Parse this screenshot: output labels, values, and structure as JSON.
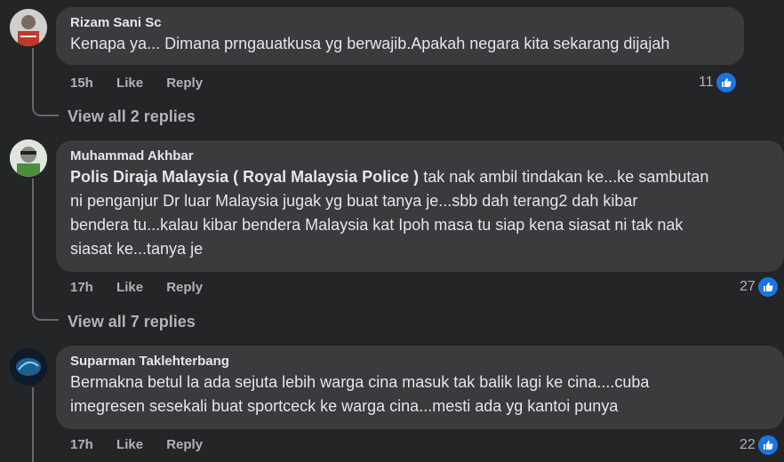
{
  "comments": [
    {
      "author": "Rizam Sani Sc",
      "text": "Kenapa ya... Dimana prngauatkusa yg berwajib.Apakah negara kita sekarang dijajah",
      "time": "15h",
      "like_label": "Like",
      "reply_label": "Reply",
      "reaction_count": "11",
      "view_replies": "View all 2 replies"
    },
    {
      "author": "Muhammad Akhbar",
      "mention": "Polis Diraja Malaysia ( Royal Malaysia Police )",
      "text_line1_rest": " tak nak ambil tindakan ke...ke sambutan",
      "text_line2": "ni penganjur Dr luar Malaysia jugak yg buat tanya je...sbb dah terang2 dah kibar",
      "text_line3": "bendera tu...kalau kibar bendera Malaysia kat Ipoh masa tu siap kena siasat ni tak nak",
      "text_line4": "siasat ke...tanya je",
      "time": "17h",
      "like_label": "Like",
      "reply_label": "Reply",
      "reaction_count": "27",
      "view_replies": "View all 7 replies"
    },
    {
      "author": "Suparman Taklehterbang",
      "text_line1": "Bermakna betul la ada sejuta lebih warga cina masuk tak balik lagi ke cina....cuba",
      "text_line2": "imegresen sesekali buat sportceck ke warga cina...mesti ada yg kantoi punya",
      "time": "17h",
      "like_label": "Like",
      "reply_label": "Reply",
      "reaction_count": "22"
    }
  ],
  "colors": {
    "background": "#242526",
    "bubble": "#3a3b3c",
    "text": "#e4e6eb",
    "muted": "#b0b3b8",
    "like_blue": "#1b74e4"
  },
  "icons": {
    "like_badge": "thumbs-up-icon"
  }
}
